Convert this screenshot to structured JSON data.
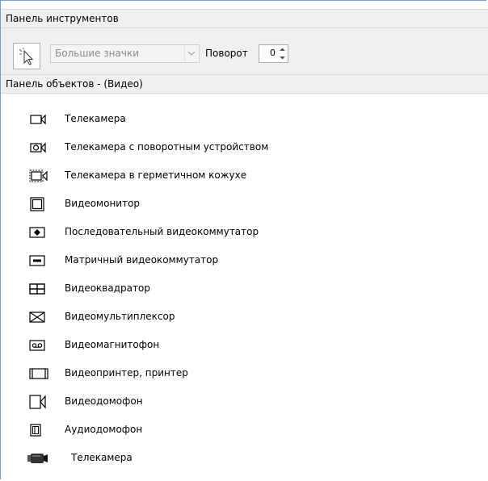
{
  "toolbar_panel": {
    "title": "Панель инструментов",
    "pointer_icon": "arrow-pointer-icon",
    "icon_size_combo": {
      "selected": "Большие значки",
      "arrow_icon": "chevron-down-icon"
    },
    "rotation": {
      "label": "Поворот",
      "value": "0"
    }
  },
  "objects_panel": {
    "title": "Панель объектов - (Видео)",
    "items": [
      {
        "label": "Телекамера",
        "icon": "camera-icon"
      },
      {
        "label": "Телекамера с поворотным устройством",
        "icon": "camera-rotator-icon"
      },
      {
        "label": "Телекамера в герметичном кожухе",
        "icon": "camera-sealed-housing-icon"
      },
      {
        "label": "Видеомонитор",
        "icon": "video-monitor-icon"
      },
      {
        "label": "Последовательный видеокоммутатор",
        "icon": "sequential-switcher-icon"
      },
      {
        "label": "Матричный видеокоммутатор",
        "icon": "matrix-switcher-icon"
      },
      {
        "label": "Видеоквадратор",
        "icon": "quad-splitter-icon"
      },
      {
        "label": "Видеомультиплексор",
        "icon": "video-multiplexer-icon"
      },
      {
        "label": "Видеомагнитофон",
        "icon": "vcr-icon"
      },
      {
        "label": "Видеопринтер, принтер",
        "icon": "video-printer-icon"
      },
      {
        "label": "Видеодомофон",
        "icon": "video-intercom-icon"
      },
      {
        "label": "Аудиодомофон",
        "icon": "audio-intercom-icon"
      },
      {
        "label": "Телекамера",
        "icon": "camera-black-icon"
      }
    ]
  }
}
